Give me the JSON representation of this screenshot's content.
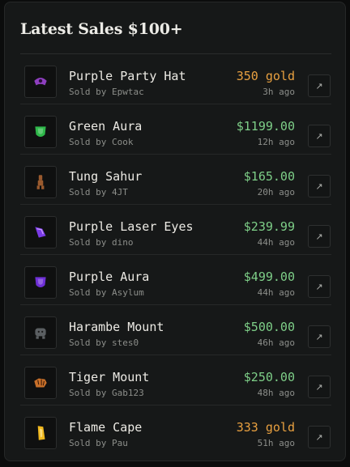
{
  "title": "Latest Sales $100+",
  "sales": [
    {
      "icon": "purple-hat-icon",
      "name": "Purple Party Hat",
      "seller": "Sold by Epwtac",
      "price": "350 gold",
      "currency": "gold",
      "time": "3h ago",
      "color": "#8e3fbf"
    },
    {
      "icon": "green-aura-icon",
      "name": "Green Aura",
      "seller": "Sold by Cook",
      "price": "$1199.00",
      "currency": "usd",
      "time": "12h ago",
      "color": "#2fb84a"
    },
    {
      "icon": "tung-sahur-icon",
      "name": "Tung Sahur",
      "seller": "Sold by 4JT",
      "price": "$165.00",
      "currency": "usd",
      "time": "20h ago",
      "color": "#9a5a2e"
    },
    {
      "icon": "laser-eyes-icon",
      "name": "Purple Laser Eyes",
      "seller": "Sold by dino",
      "price": "$239.99",
      "currency": "usd",
      "time": "44h ago",
      "color": "#7a3be6"
    },
    {
      "icon": "purple-aura-icon",
      "name": "Purple Aura",
      "seller": "Sold by Asylum",
      "price": "$499.00",
      "currency": "usd",
      "time": "44h ago",
      "color": "#6e2fd6"
    },
    {
      "icon": "harambe-mount-icon",
      "name": "Harambe Mount",
      "seller": "Sold by stes0",
      "price": "$500.00",
      "currency": "usd",
      "time": "46h ago",
      "color": "#5b5f62"
    },
    {
      "icon": "tiger-mount-icon",
      "name": "Tiger Mount",
      "seller": "Sold by Gab123",
      "price": "$250.00",
      "currency": "usd",
      "time": "48h ago",
      "color": "#c8702a"
    },
    {
      "icon": "flame-cape-icon",
      "name": "Flame Cape",
      "seller": "Sold by Pau",
      "price": "333 gold",
      "currency": "gold",
      "time": "51h ago",
      "color": "#f0b81e"
    }
  ],
  "open_glyph": "↗"
}
